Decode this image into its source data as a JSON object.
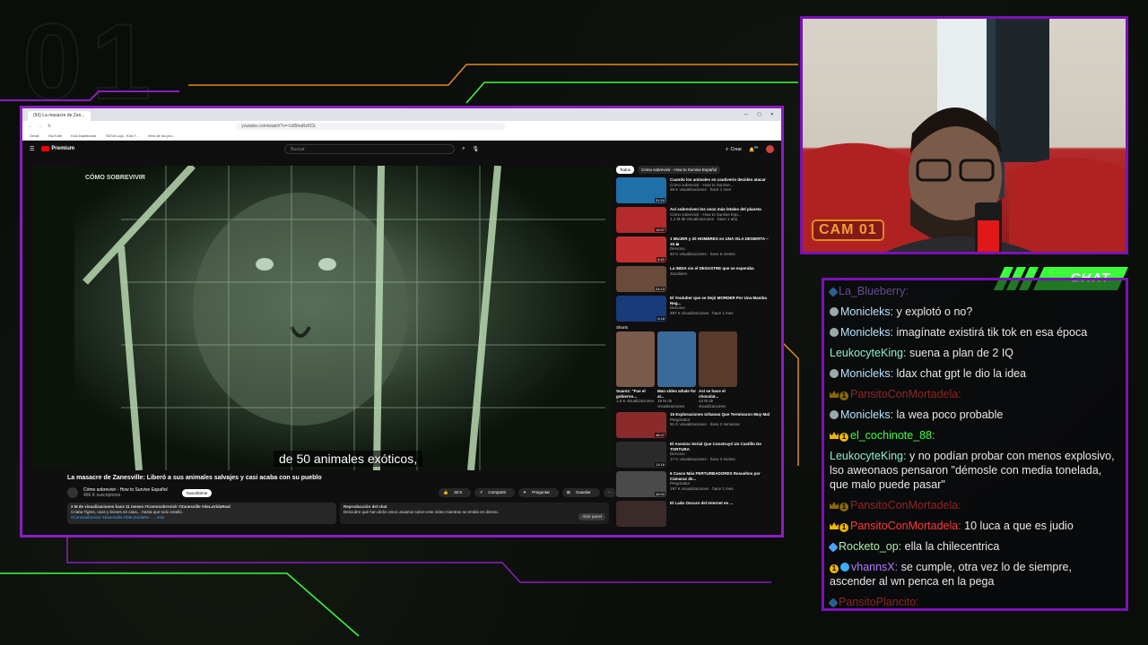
{
  "overlay": {
    "bg_number": "01",
    "cam_label": "CAM 01",
    "chat_label": "CHAT",
    "accent_purple": "#7a12b6",
    "accent_green": "#3cff3c",
    "accent_orange": "#e08a20"
  },
  "browser": {
    "tab_title": "(50) La masacre de Zan...",
    "url": "youtube.com/watch?v=-Ud5haRz6Ck",
    "bookmarks": [
      "Gmail",
      "YouTube",
      "Kick Dashboard",
      "TikTok Logi - Kick T...",
      "retro de los pro..."
    ]
  },
  "youtube": {
    "logo": "Premium",
    "search_placeholder": "Buscar",
    "create_label": "Crear",
    "notif_count": "9+",
    "video": {
      "watermark": "CÓMO SOBREVIVIR",
      "subtitle": "de 50 animales exóticos,",
      "title": "La masacre de Zanesville: Liberó a sus animales salvajes y casi acaba con su pueblo",
      "channel": "Cómo sobrevivir - How to Survive Español",
      "subscribers": "466 K suscriptores",
      "subscribe_label": "Suscribirme",
      "likes": "30 K",
      "share_label": "Compartir",
      "ask_label": "Preguntar",
      "save_label": "Guardar",
      "desc_line1": "2 M de visualizaciones hace 11 meses #Comosobrevivir #Zanesville #deLaVidaReal",
      "desc_line2": "Criaba Tigres, osos y leones en casa... Hasta que todo estalló.",
      "desc_line3": "#Comosobrevivir #Zanesville #DeLaVidaRe...   ...más",
      "replay_title": "Reproducción del chat",
      "replay_text": "Descubre qué han dicho otros usuarios sobre este vídeo mientras se emitía en directo.",
      "replay_btn": "Abrir panel"
    },
    "chips": [
      "Todos",
      "Cómo sobrevivir - How to Survive Español"
    ],
    "recommendations": [
      {
        "title": "Cuando los animales en cautiverio deciden atacar",
        "channel": "Cómo sobrevivir - How to Survive...",
        "stats": "48 K visualizaciones · hace 1 mes",
        "duration": "31:24",
        "color": "#1f6fa8"
      },
      {
        "title": "Así sobreviven los osos más letales del planeta",
        "channel": "Cómo sobrevivir - How to Survive Esp...",
        "stats": "1,1 M de visualizaciones · hace 1 año",
        "duration": "15:07",
        "color": "#b52a2a"
      },
      {
        "title": "1 MUJER y 20 HOMBRES en UNA ISLA DESIERTA ~ 15 ☠",
        "channel": "Dervoso",
        "stats": "40 K visualizaciones · hace 6 meses",
        "duration": "8:41",
        "color": "#c43030"
      },
      {
        "title": "La INDIA vio el DESASTRE que se esperaba",
        "channel": "Jacobiem",
        "stats": "",
        "duration": "24:13",
        "color": "#6a4a3a"
      },
      {
        "title": "El Youtuber que se Dejó MORDER Por Una Mamba Neg...",
        "channel": "Dervoso",
        "stats": "387 K visualizaciones · hace 1 mes",
        "duration": "8:18",
        "color": "#1a3b7a"
      }
    ],
    "shorts_label": "Shorts",
    "shorts": [
      {
        "title": "Suarez: \"Fue el gobierno...",
        "views": "1,6 K visualizaciones",
        "color": "#7a5a4a"
      },
      {
        "title": "Man video whale for al...",
        "views": "19 M de visualizaciones",
        "color": "#3a6a9a"
      },
      {
        "title": "Así se hace el chocolat...",
        "views": "43 M de visualizaciones",
        "color": "#5a3a2a"
      }
    ],
    "recommendations2": [
      {
        "title": "15 Exploraciones Urbanas Que Terminaron Muy Mal",
        "channel": "Pergonator",
        "stats": "51 K visualizaciones · hace 2 semanas",
        "duration": "48:47",
        "color": "#8a2a2a"
      },
      {
        "title": "El Asesino Serial Que Construyó Un Castillo De TORTURA",
        "channel": "Dervoso",
        "stats": "17 K visualizaciones · hace 3 meses",
        "duration": "13:16",
        "color": "#2a2a2a"
      },
      {
        "title": "6 Casos Más PERTURBADORES Resueltos por Cámaras de...",
        "channel": "Pergonator",
        "stats": "197 K visualizaciones · hace 1 mes",
        "duration": "44:04",
        "color": "#4a4a4a"
      },
      {
        "title": "El Lado Oscuro del Internet en ...",
        "channel": "",
        "stats": "",
        "duration": "",
        "color": "#3a2a2a"
      }
    ]
  },
  "chat": [
    {
      "user": "La_Blueberry:",
      "user_color": "#b57cff",
      "text": "",
      "badges": "sword",
      "faded": true
    },
    {
      "user": "Monicleks:",
      "user_color": "#b7e3ff",
      "text": "y explotó o no?",
      "badges": "face"
    },
    {
      "user": "Monicleks:",
      "user_color": "#b7e3ff",
      "text": "imagínate existirá tik tok en esa época",
      "badges": "face"
    },
    {
      "user": "LeukocyteKing:",
      "user_color": "#8af0c8",
      "text": "suena a plan de 2 IQ",
      "badges": ""
    },
    {
      "user": "Monicleks:",
      "user_color": "#b7e3ff",
      "text": "ldax chat gpt le dio la idea",
      "badges": "face"
    },
    {
      "user": "PansitoConMortadela:",
      "user_color": "#ff3a3a",
      "text": "",
      "badges": "crown",
      "faded": true
    },
    {
      "user": "Monicleks:",
      "user_color": "#b7e3ff",
      "text": "la wea poco probable",
      "badges": "face"
    },
    {
      "user": "el_cochinote_88:",
      "user_color": "#3cff3c",
      "text": "",
      "badges": "crown"
    },
    {
      "user": "LeukocyteKing:",
      "user_color": "#8af0c8",
      "text": "y no podían probar con menos explosivo, lso aweonaos pensaron \"démosle con media tonelada, que malo puede pasar\"",
      "badges": ""
    },
    {
      "user": "PansitoConMortadela:",
      "user_color": "#ff3a3a",
      "text": "",
      "badges": "crown",
      "faded": true
    },
    {
      "user": "PansitoConMortadela:",
      "user_color": "#ff3a3a",
      "text": "10 luca a que es judio",
      "badges": "crown"
    },
    {
      "user": "Rocketo_op:",
      "user_color": "#a8f0a8",
      "text": "ella la chilecentrica",
      "badges": "sword"
    },
    {
      "user": "vhannsX:",
      "user_color": "#b57cff",
      "text": "se cumple, otra vez lo de siempre, ascender al wn penca en la pega",
      "badges": "coin"
    },
    {
      "user": "PansitoPlancito:",
      "user_color": "#ff3a3a",
      "text": "",
      "badges": "sword",
      "faded": true
    }
  ]
}
